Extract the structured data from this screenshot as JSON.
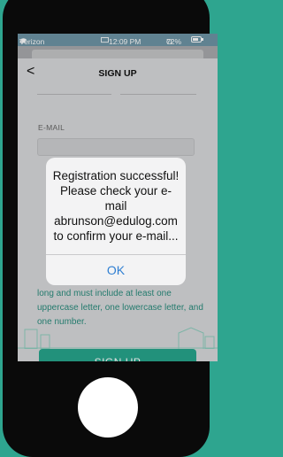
{
  "status_bar": {
    "carrier": "Verizon",
    "time": "12:09 PM",
    "battery_percent": "72%",
    "battery_level": 0.72
  },
  "nav": {
    "back_glyph": "<",
    "title": "SIGN UP"
  },
  "form": {
    "email_label": "E-MAIL",
    "email_value": "",
    "password_hint": "Password must be at least 8 characters long and must include at least one uppercase letter, one lowercase letter, and one number.",
    "signup_label": "SIGN UP"
  },
  "alert": {
    "lines": [
      "Registration successful!",
      "Please check your e-",
      "mail",
      "abrunson@edulog.com",
      "to confirm your e-mail..."
    ],
    "ok_label": "OK"
  },
  "colors": {
    "background": "#2ea58f",
    "accent": "#27a58c",
    "alert_button": "#2f7fd2",
    "status_bar": "#6e95a5"
  },
  "icons": [
    "wifi-icon",
    "back-chevron-icon",
    "bluetooth-icon",
    "battery-icon",
    "home-button"
  ]
}
